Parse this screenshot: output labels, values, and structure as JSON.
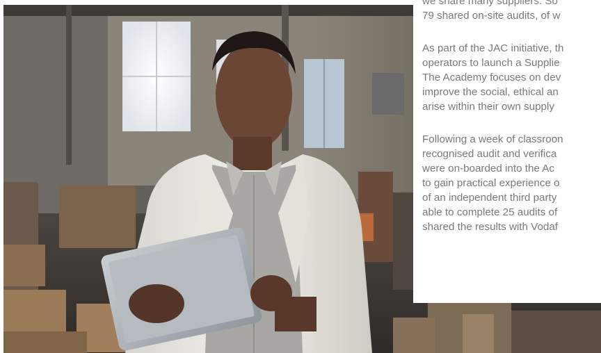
{
  "article": {
    "paragraphs": [
      {
        "lines": [
          "we share many suppliers. So",
          "79 shared on-site audits, of w"
        ]
      },
      {
        "lines": [
          "As part of the JAC initiative, th",
          "operators to launch a Supplie",
          "The Academy focuses on dev",
          "improve the social, ethical an",
          "arise within their own supply"
        ]
      },
      {
        "lines": [
          "Following a week of classroon",
          "recognised audit and verifica",
          "were on-boarded into the Ac",
          "to gain practical experience o",
          "of an independent third party",
          "able to complete 25 audits of",
          "shared the results with Vodaf"
        ]
      }
    ]
  },
  "photo": {
    "subject": "woman-using-tablet-in-warehouse"
  }
}
